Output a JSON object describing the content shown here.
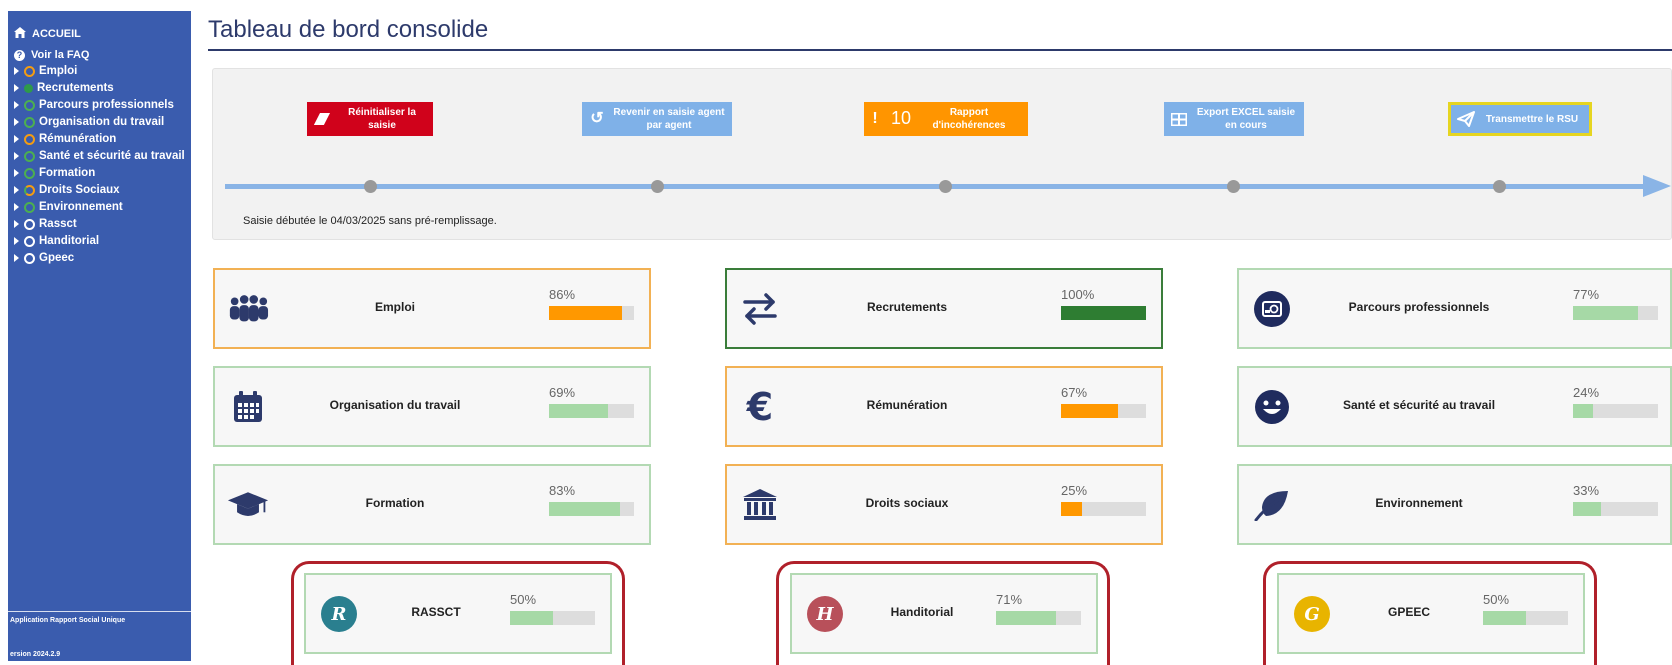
{
  "sidebar": {
    "home": "ACCUEIL",
    "faq": "Voir la FAQ",
    "items": [
      {
        "label": "Emploi",
        "status": "orange"
      },
      {
        "label": "Recrutements",
        "status": "green-dot"
      },
      {
        "label": "Parcours professionnels",
        "status": "green"
      },
      {
        "label": "Organisation du travail",
        "status": "green"
      },
      {
        "label": "Rémunération",
        "status": "orange"
      },
      {
        "label": "Santé et sécurité au travail",
        "status": "green"
      },
      {
        "label": "Formation",
        "status": "green"
      },
      {
        "label": "Droits Sociaux",
        "status": "half"
      },
      {
        "label": "Environnement",
        "status": "green"
      },
      {
        "label": "Rassct",
        "status": "white"
      },
      {
        "label": "Handitorial",
        "status": "white"
      },
      {
        "label": "Gpeec",
        "status": "white"
      }
    ],
    "footer_app": "Application Rapport Social Unique",
    "footer_version": "ersion 2024.2.9"
  },
  "page_title": "Tableau de bord consolide",
  "toolbar": {
    "reset": "Réinitialiser la saisie",
    "back": "Revenir en saisie agent par agent",
    "report_count": "10",
    "report": "Rapport d'incohérences",
    "export": "Export EXCEL saisie en cours",
    "transmit": "Transmettre le RSU"
  },
  "saisie_text": "Saisie débutée le 04/03/2025 sans pré-remplissage.",
  "cards": [
    {
      "name": "Emploi",
      "pct": "86%",
      "value": 86,
      "color": "orange"
    },
    {
      "name": "Recrutements",
      "pct": "100%",
      "value": 100,
      "color": "green"
    },
    {
      "name": "Parcours professionnels",
      "pct": "77%",
      "value": 77,
      "color": "light"
    },
    {
      "name": "Organisation du travail",
      "pct": "69%",
      "value": 69,
      "color": "light"
    },
    {
      "name": "Rémunération",
      "pct": "67%",
      "value": 67,
      "color": "orange"
    },
    {
      "name": "Santé et sécurité au travail",
      "pct": "24%",
      "value": 24,
      "color": "light"
    },
    {
      "name": "Formation",
      "pct": "83%",
      "value": 83,
      "color": "light"
    },
    {
      "name": "Droits sociaux",
      "pct": "25%",
      "value": 25,
      "color": "orange"
    },
    {
      "name": "Environnement",
      "pct": "33%",
      "value": 33,
      "color": "light"
    }
  ],
  "small_cards": [
    {
      "name": "RASSCT",
      "pct": "50%",
      "value": 50,
      "letter": "R",
      "circle": "#2a7f8f"
    },
    {
      "name": "Handitorial",
      "pct": "71%",
      "value": 71,
      "letter": "H",
      "circle": "#b8505a"
    },
    {
      "name": "GPEEC",
      "pct": "50%",
      "value": 50,
      "letter": "G",
      "circle": "#e8b400"
    }
  ],
  "colors": {
    "sidebar": "#3a5cae",
    "title": "#2d3a6b",
    "reset_btn": "#d0021b",
    "back_btn": "#7fb1e8",
    "report_btn": "#ff9500",
    "export_btn": "#7fb1e8",
    "transmit_btn": "#7fb1e8",
    "transmit_border": "#e6d520"
  }
}
